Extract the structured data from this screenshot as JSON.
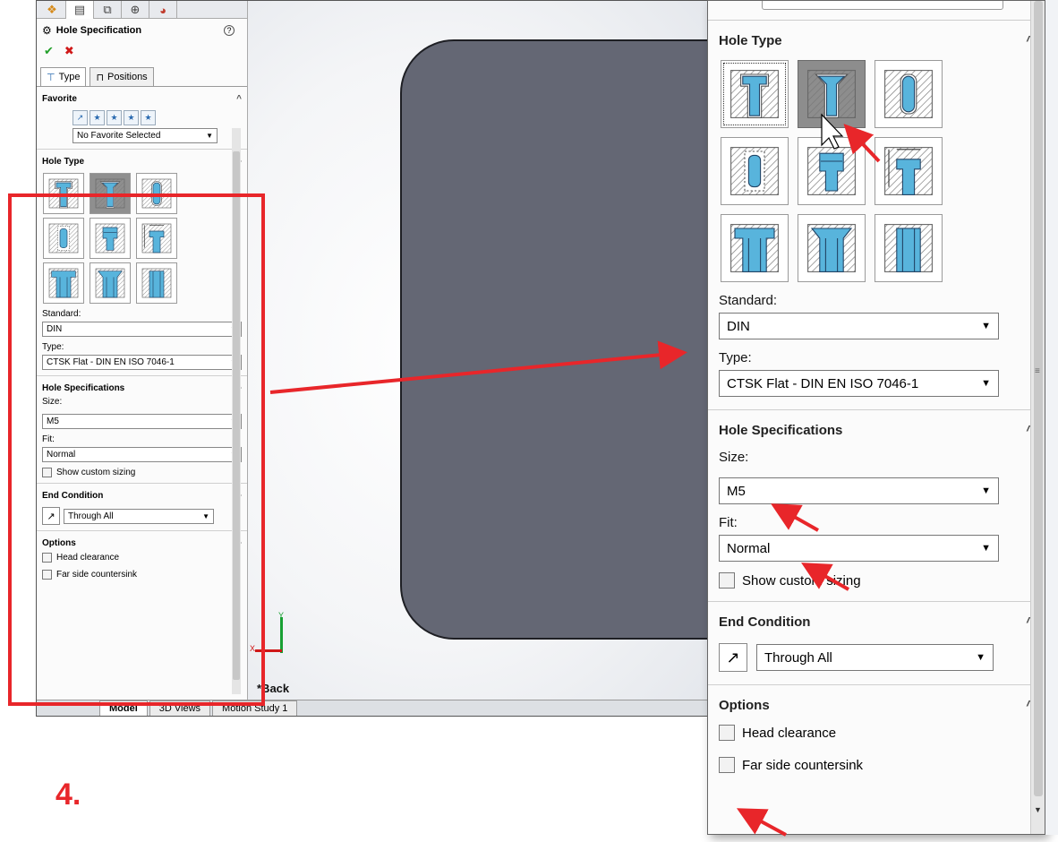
{
  "left_panel": {
    "title": "Hole Specification",
    "tabs": {
      "type": "Type",
      "positions": "Positions"
    },
    "favorite": {
      "header": "Favorite",
      "selected": "No Favorite Selected"
    },
    "hole_type": {
      "header": "Hole Type",
      "standard_label": "Standard:",
      "standard": "DIN",
      "type_label": "Type:",
      "type": "CTSK Flat - DIN EN ISO 7046-1"
    },
    "hole_specs": {
      "header": "Hole Specifications",
      "size_label": "Size:",
      "size": "M5",
      "fit_label": "Fit:",
      "fit": "Normal",
      "custom_sizing": "Show custom sizing"
    },
    "end_condition": {
      "header": "End Condition",
      "value": "Through All"
    },
    "options": {
      "header": "Options",
      "head_clearance": "Head clearance",
      "far_side": "Far side countersink"
    }
  },
  "viewport": {
    "view_label": "*Back",
    "triad_y": "Y",
    "triad_x": "X",
    "bottom_tabs": [
      "Model",
      "3D Views",
      "Motion Study 1"
    ]
  },
  "zoom_panel": {
    "hole_type": {
      "header": "Hole Type",
      "standard_label": "Standard:",
      "standard": "DIN",
      "type_label": "Type:",
      "type": "CTSK Flat - DIN EN ISO 7046-1"
    },
    "hole_specs": {
      "header": "Hole Specifications",
      "size_label": "Size:",
      "size": "M5",
      "fit_label": "Fit:",
      "fit": "Normal",
      "custom_sizing": "Show custom sizing"
    },
    "end_condition": {
      "header": "End Condition",
      "value": "Through All"
    },
    "options": {
      "header": "Options",
      "head_clearance": "Head clearance",
      "far_side": "Far side countersink"
    }
  },
  "step_number": "4.",
  "colors": {
    "highlight": "#e8262a",
    "part": "#646774",
    "hole_blue": "#58b4dc",
    "selected_cell": "#8d8d8d"
  },
  "hole_types": [
    "counterbore-icon",
    "countersink-icon",
    "hole-icon",
    "straight-tap-icon",
    "tapered-tap-icon",
    "legacy-hole-icon",
    "counterbore-slot-icon",
    "countersink-slot-icon",
    "slot-icon"
  ]
}
